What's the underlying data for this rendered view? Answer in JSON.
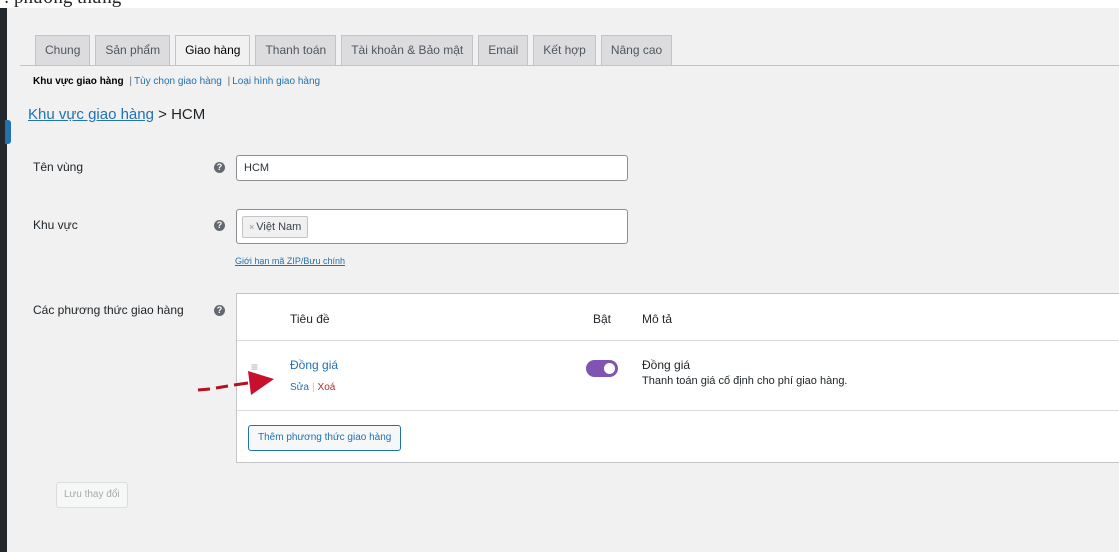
{
  "header_fragment": ": phương thưng",
  "tabs": [
    {
      "label": "Chung",
      "active": false
    },
    {
      "label": "Sản phẩm",
      "active": false
    },
    {
      "label": "Giao hàng",
      "active": true
    },
    {
      "label": "Thanh toán",
      "active": false
    },
    {
      "label": "Tài khoản & Bảo mật",
      "active": false
    },
    {
      "label": "Email",
      "active": false
    },
    {
      "label": "Kết hợp",
      "active": false
    },
    {
      "label": "Nâng cao",
      "active": false
    }
  ],
  "subnav": {
    "current": "Khu vực giao hàng",
    "link1": "Tùy chọn giao hàng",
    "link2": "Loại hình giao hàng",
    "separator": "|"
  },
  "breadcrumb": {
    "link": "Khu vực giao hàng",
    "rest": " > HCM"
  },
  "form": {
    "zone_name": {
      "label": "Tên vùng",
      "value": "HCM"
    },
    "region": {
      "label": "Khu vực",
      "chip": "Việt Nam",
      "chip_remove": "×",
      "zip_link": "Giới hạn mã ZIP/Bưu chính"
    },
    "methods_label": "Các phương thức giao hàng",
    "help_glyph": "?"
  },
  "methods": {
    "headers": {
      "title": "Tiêu đề",
      "enabled": "Bật",
      "description": "Mô tả"
    },
    "rows": [
      {
        "title": "Đồng giá",
        "edit": "Sửa",
        "delete": "Xoá",
        "enabled": true,
        "desc_title": "Đồng giá",
        "desc_text": "Thanh toán giá cố định cho phí giao hàng."
      }
    ],
    "add_button": "Thêm phương thức giao hàng"
  },
  "save_button": "Lưu thay đổi",
  "colors": {
    "accent": "#2271b1",
    "toggle_on": "#7f54b3",
    "delete": "#b32d2e",
    "arrow": "#c8102e"
  }
}
